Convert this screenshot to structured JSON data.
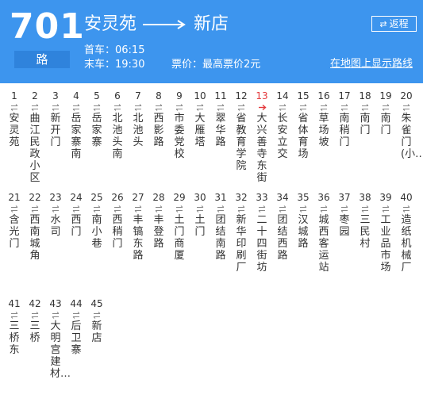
{
  "header": {
    "route_number": "701",
    "route_suffix": "路",
    "origin": "安灵苑",
    "destination": "新店",
    "first_bus": "首车：06:15",
    "last_bus": "末车：19:30",
    "fare": "票价：最高票价2元",
    "return_button": "返程",
    "map_link": "在地图上显示路线",
    "colors": {
      "header_bg": "#3d95ee",
      "highlight": "#e4393c"
    }
  },
  "stops": [
    {
      "num": "1",
      "name": "安灵苑"
    },
    {
      "num": "2",
      "name": "曲江民政小区"
    },
    {
      "num": "3",
      "name": "新开门"
    },
    {
      "num": "4",
      "name": "岳家寨南"
    },
    {
      "num": "5",
      "name": "岳家寨"
    },
    {
      "num": "6",
      "name": "北池头南"
    },
    {
      "num": "7",
      "name": "北池头"
    },
    {
      "num": "8",
      "name": "西影路"
    },
    {
      "num": "9",
      "name": "市委党校"
    },
    {
      "num": "10",
      "name": "大雁塔"
    },
    {
      "num": "11",
      "name": "翠华路"
    },
    {
      "num": "12",
      "name": "省教育学院"
    },
    {
      "num": "13",
      "name": "大兴善寺东街",
      "highlight": true
    },
    {
      "num": "14",
      "name": "长安立交"
    },
    {
      "num": "15",
      "name": "省体育场"
    },
    {
      "num": "16",
      "name": "草场坡"
    },
    {
      "num": "17",
      "name": "南稍门"
    },
    {
      "num": "18",
      "name": "南门"
    },
    {
      "num": "19",
      "name": "南门"
    },
    {
      "num": "20",
      "name": "朱雀门(小…"
    },
    {
      "num": "21",
      "name": "含光门"
    },
    {
      "num": "22",
      "name": "西南城角"
    },
    {
      "num": "23",
      "name": "水司"
    },
    {
      "num": "24",
      "name": "西门"
    },
    {
      "num": "25",
      "name": "南小巷"
    },
    {
      "num": "26",
      "name": "西稍门"
    },
    {
      "num": "27",
      "name": "丰镐东路"
    },
    {
      "num": "28",
      "name": "丰登路"
    },
    {
      "num": "29",
      "name": "土门商厦"
    },
    {
      "num": "30",
      "name": "土门"
    },
    {
      "num": "31",
      "name": "团结南路"
    },
    {
      "num": "32",
      "name": "新华印刷厂"
    },
    {
      "num": "33",
      "name": "二十四街坊"
    },
    {
      "num": "34",
      "name": "团结西路"
    },
    {
      "num": "35",
      "name": "汉城路"
    },
    {
      "num": "36",
      "name": "城西客运站"
    },
    {
      "num": "37",
      "name": "枣园"
    },
    {
      "num": "38",
      "name": "三民村"
    },
    {
      "num": "39",
      "name": "工业品市场"
    },
    {
      "num": "40",
      "name": "造纸机械厂"
    },
    {
      "num": "41",
      "name": "三桥东"
    },
    {
      "num": "42",
      "name": "三桥"
    },
    {
      "num": "43",
      "name": "大明宫建材…"
    },
    {
      "num": "44",
      "name": "后卫寨"
    },
    {
      "num": "45",
      "name": "新店"
    }
  ]
}
